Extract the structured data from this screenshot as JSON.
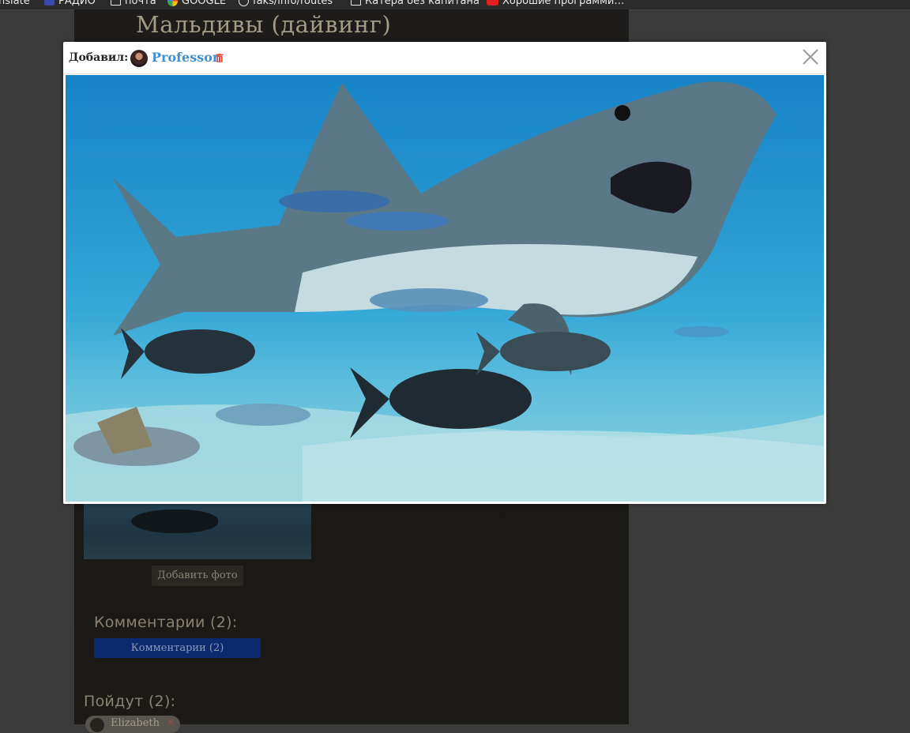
{
  "bookmarks": [
    {
      "label": "nslate",
      "icon": "none"
    },
    {
      "label": "РАДИО",
      "icon": "radio-icon"
    },
    {
      "label": "почта",
      "icon": "folder-icon"
    },
    {
      "label": "GOOGLE",
      "icon": "google-icon"
    },
    {
      "label": "faks/info/routes",
      "icon": "globe-icon"
    },
    {
      "label": "Катера без капитана",
      "icon": "folder-icon"
    },
    {
      "label": "Хорошие программи…",
      "icon": "youtube-icon"
    }
  ],
  "page": {
    "title": "Мальдивы (дайвинг)",
    "add_photo_label": "Добавить фото",
    "comments_heading": "Комментарии (2):",
    "comments_button_label": "Комментарии (2)",
    "going_heading": "Пойдут (2):",
    "going_people": [
      "Elizabeth"
    ]
  },
  "modal": {
    "added_by_label": "Добавил:",
    "author_name": "Professor",
    "photo_alt": "",
    "colors": {
      "author_link": "#3d8fd1",
      "delete": "#e04a3a"
    },
    "icons": {
      "close": "close-icon",
      "delete": "trash-icon",
      "avatar": "avatar"
    }
  }
}
